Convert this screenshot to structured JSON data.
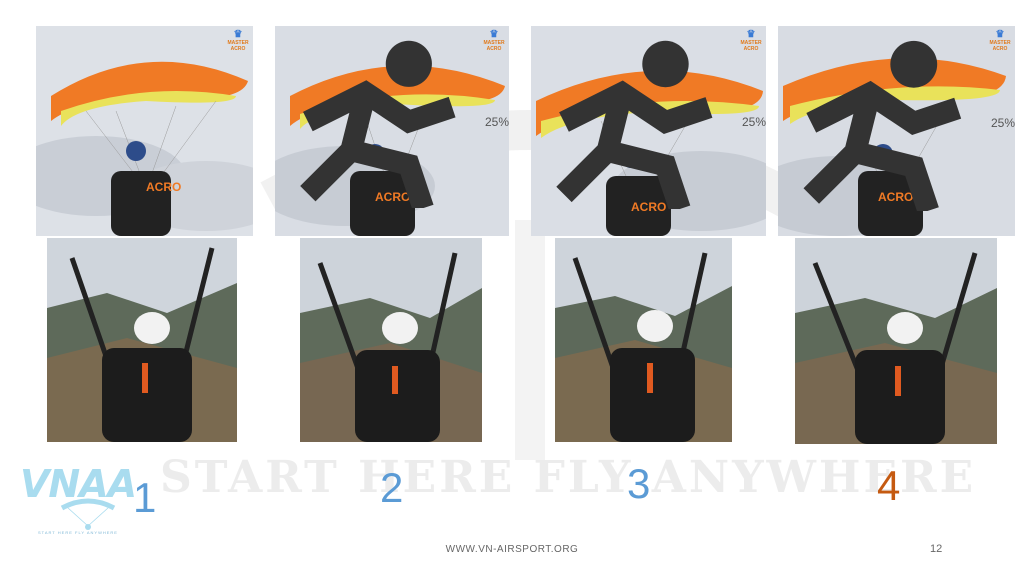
{
  "slide": {
    "watermark_text": "START HERE FLY ANYWHERE",
    "footer_url": "WWW.VN-AIRSPORT.ORG",
    "page_number": "12"
  },
  "logo": {
    "text": "VNAA",
    "tagline": "START HERE FLY ANYWHERE"
  },
  "top_row": [
    {
      "speed": "",
      "badge_lines": [
        "MASTER",
        "ACRO"
      ]
    },
    {
      "speed": "25%",
      "badge_lines": [
        "MASTER",
        "ACRO"
      ]
    },
    {
      "speed": "25%",
      "badge_lines": [
        "MASTER",
        "ACRO"
      ]
    },
    {
      "speed": "25%",
      "badge_lines": [
        "MASTER",
        "ACRO"
      ]
    }
  ],
  "steps": [
    {
      "label": "1",
      "color": "#5b9bd5"
    },
    {
      "label": "2",
      "color": "#5b9bd5"
    },
    {
      "label": "3",
      "color": "#5b9bd5"
    },
    {
      "label": "4",
      "color": "#c55a11"
    }
  ],
  "colors": {
    "wing_orange": "#f07a25",
    "wing_yellow": "#e9e25a",
    "sky": "#d9dde4",
    "mountains": "#5e6a5a",
    "step_blue": "#5b9bd5",
    "step_orange": "#c55a11"
  }
}
